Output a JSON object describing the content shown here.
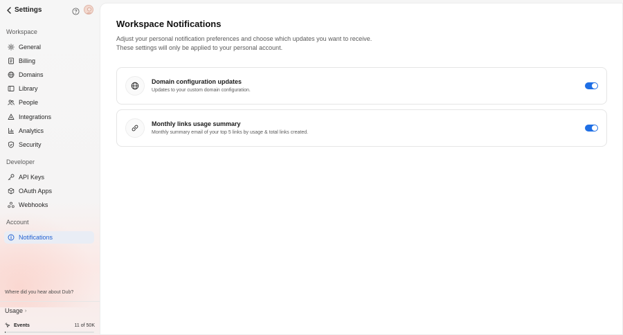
{
  "sidebar": {
    "title": "Settings",
    "sections": {
      "workspace": "Workspace",
      "developer": "Developer",
      "account": "Account"
    },
    "workspace_items": [
      {
        "label": "General",
        "icon": "gear-icon"
      },
      {
        "label": "Billing",
        "icon": "receipt-icon"
      },
      {
        "label": "Domains",
        "icon": "globe-icon"
      },
      {
        "label": "Library",
        "icon": "library-icon"
      },
      {
        "label": "People",
        "icon": "people-icon"
      },
      {
        "label": "Integrations",
        "icon": "integrations-icon"
      },
      {
        "label": "Analytics",
        "icon": "analytics-icon"
      },
      {
        "label": "Security",
        "icon": "shield-icon"
      }
    ],
    "developer_items": [
      {
        "label": "API Keys",
        "icon": "key-icon"
      },
      {
        "label": "OAuth Apps",
        "icon": "cube-icon"
      },
      {
        "label": "Webhooks",
        "icon": "webhook-icon"
      }
    ],
    "account_items": [
      {
        "label": "Notifications",
        "icon": "info-circle-icon",
        "active": true
      }
    ],
    "survey_text": "Where did you hear about Dub?",
    "usage_label": "Usage",
    "events": {
      "label": "Events",
      "count": "11 of 50K",
      "progress": 0.0002
    }
  },
  "main": {
    "title": "Workspace Notifications",
    "description_line1": "Adjust your personal notification preferences and choose which updates you want to receive.",
    "description_line2": "These settings will only be applied to your personal account.",
    "cards": [
      {
        "title": "Domain configuration updates",
        "subtitle": "Updates to your custom domain configuration.",
        "icon": "globe-icon",
        "enabled": true
      },
      {
        "title": "Monthly links usage summary",
        "subtitle": "Monthly summary email of your top 5 links by usage & total links created.",
        "icon": "links-icon",
        "enabled": true
      }
    ]
  },
  "colors": {
    "accent": "#1f6fe5",
    "active_nav_bg": "#e9edf5",
    "active_nav_text": "#1f5fd1"
  }
}
